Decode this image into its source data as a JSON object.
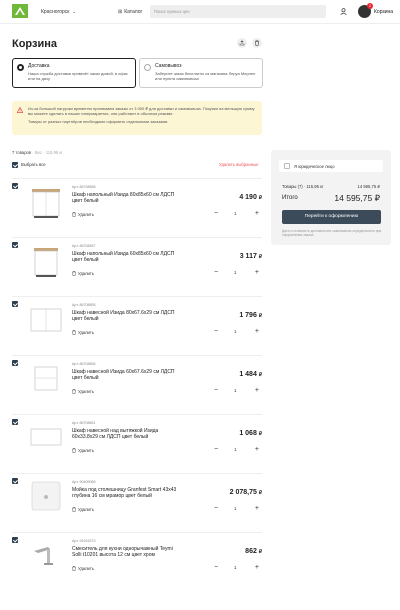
{
  "header": {
    "city": "Красногорск",
    "catalog": "Каталог",
    "search_placeholder": "Поиск нужных цен",
    "cart_count": "2",
    "cart_label": "Корзина"
  },
  "page": {
    "title": "Корзина"
  },
  "delivery_options": [
    {
      "title": "Доставка",
      "desc": "Наша служба доставки привезёт заказ домой, в офис или на дачу"
    },
    {
      "title": "Самовывоз",
      "desc": "Заберите заказ бесплатно из магазина Леруа Мерлен или пункта самовывоза"
    }
  ],
  "notice": {
    "line1": "Из-за большой нагрузки временно принимаем заказы от 3 000 ₽ для доставки и самовывоза. Покупки на меньшую сумму вы можете сделать в наших гипермаркетах, они работают в обычном режиме.",
    "line2": "Товары от разных партнёров необходимо оформить отдельными заказами."
  },
  "list": {
    "count": "7 товаров",
    "weight": "· Вес · 115,95 кг",
    "select_all": "Выбрать все",
    "delete_selected": "Удалить выбранные",
    "remove_label": "Удалить"
  },
  "items": [
    {
      "art": "Арт. 86708858",
      "name": "Шкаф напольный Изида 80х85х60 см ЛДСП цвет белый",
      "price": "4 190",
      "qty": "1"
    },
    {
      "art": "Арт. 86708857",
      "name": "Шкаф напольный Изида 60х85х60 см ЛДСП цвет белый",
      "price": "3 117",
      "qty": "1"
    },
    {
      "art": "Арт. 86708855",
      "name": "Шкаф навесной Изида 80х67.6х29 см ЛДСП цвет белый",
      "price": "1 796",
      "qty": "1"
    },
    {
      "art": "Арт. 86708856",
      "name": "Шкаф навесной Изида 60х67.6х29 см ЛДСП цвет белый",
      "price": "1 484",
      "qty": "1"
    },
    {
      "art": "Арт. 86708851",
      "name": "Шкаф навесной над вытяжкой Изида 60х33.8х29 см ЛДСП цвет белый",
      "price": "1 068",
      "qty": "1"
    },
    {
      "art": "Арт. 90409089",
      "name": "Мойка под столешницу Granfest Smart 43х43 глубина 16 см мрамор цвет белый",
      "price": "2 078,75",
      "qty": "1"
    },
    {
      "art": "Арт. 91916373",
      "name": "Смеситель для кухни однорычажный Teymi Solli t10201 высота 12 см цвет хром",
      "price": "862",
      "qty": "1"
    }
  ],
  "currency": "₽",
  "summary": {
    "legal": "Я юридическое лицо",
    "goods_label": "Товары (7) · 115,95 кг",
    "goods_value": "14 595,75 ₽",
    "total_label": "Итого",
    "total_value": "14 595,75 ₽",
    "checkout": "Перейти к оформлению",
    "fine": "Дата и стоимость доставки или самовывоза определяются при оформлении заказа"
  },
  "colors": {
    "brand_green": "#6fb83a",
    "checkout": "#3c4b5a",
    "danger": "#e55555",
    "notice": "#fdf6d5"
  }
}
